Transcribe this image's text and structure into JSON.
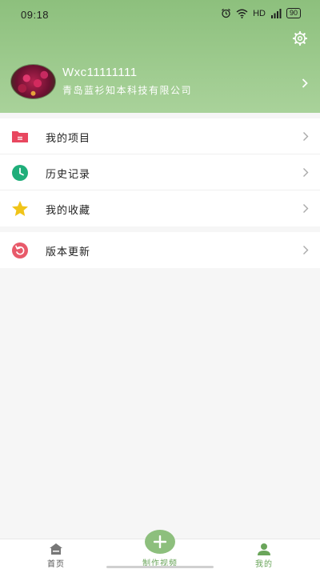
{
  "status_bar": {
    "time": "09:18",
    "network": "HD",
    "battery": "90",
    "icons": [
      "alarm-icon",
      "wifi-icon",
      "signal-icon",
      "battery-icon"
    ]
  },
  "header": {
    "settings_icon": "gear-icon",
    "user_name": "Wxc11111111",
    "company": "青岛蓝衫知本科技有限公司",
    "avatar_icon": "avatar"
  },
  "menu": {
    "group1": [
      {
        "label": "我的项目",
        "icon": "folder-icon",
        "color": "#e8475f"
      },
      {
        "label": "历史记录",
        "icon": "clock-icon",
        "color": "#1fae7a"
      },
      {
        "label": "我的收藏",
        "icon": "star-icon",
        "color": "#f0c419"
      }
    ],
    "group2": [
      {
        "label": "版本更新",
        "icon": "refresh-icon",
        "color": "#e85a6a"
      }
    ]
  },
  "tab_bar": {
    "home": "首页",
    "make": "制作视频",
    "mine": "我的",
    "active": "mine"
  },
  "colors": {
    "header_green": "#8dc07d",
    "accent_green": "#6aa55a"
  }
}
